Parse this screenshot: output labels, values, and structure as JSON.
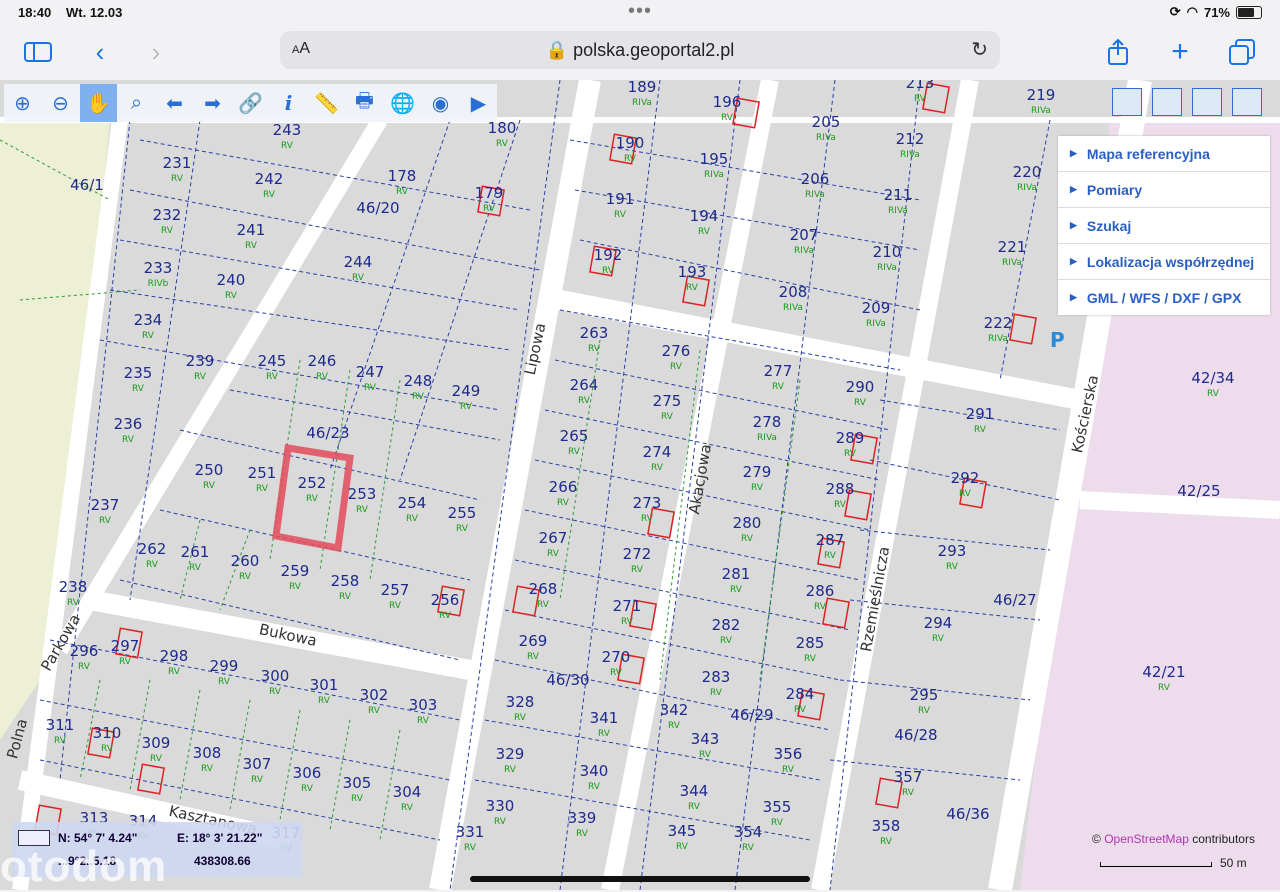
{
  "status": {
    "time": "18:40",
    "date": "Wt. 12.03",
    "battery": "71%"
  },
  "browser": {
    "aa": "AA",
    "url": "polska.geoportal2.pl"
  },
  "menu": [
    "Mapa referencyjna",
    "Pomiary",
    "Szukaj",
    "Lokalizacja współrzędnej",
    "GML / WFS / DXF / GPX"
  ],
  "coords": {
    "n": "N: 54° 7' 4.24\"",
    "e": "E: 18° 3' 21.22\"",
    "y": "438308.66",
    "x": "...9°2..5.18"
  },
  "attribution": {
    "prefix": "©",
    "osm": "OpenStreetMap",
    "suffix": "contributors"
  },
  "scale": "50 m",
  "watermark": "otodom",
  "streets": [
    "Lipowa",
    "Akacjowa",
    "Rzemieślnicza",
    "Kościerska",
    "Bukowa",
    "Parkowa",
    "Polna",
    "Kasztanowa"
  ],
  "parcels": [
    {
      "n": "243",
      "c": "RV"
    },
    {
      "n": "180",
      "c": "RV"
    },
    {
      "n": "189",
      "c": "RIVa"
    },
    {
      "n": "196",
      "c": "RV"
    },
    {
      "n": "205",
      "c": "RIVa"
    },
    {
      "n": "212",
      "c": "RIVa"
    },
    {
      "n": "213",
      "c": "RV"
    },
    {
      "n": "219",
      "c": "RIVa"
    },
    {
      "n": "231",
      "c": "RV"
    },
    {
      "n": "242",
      "c": "RV"
    },
    {
      "n": "178",
      "c": "RV"
    },
    {
      "n": "179",
      "c": "RV"
    },
    {
      "n": "190",
      "c": "RV"
    },
    {
      "n": "195",
      "c": "RIVa"
    },
    {
      "n": "206",
      "c": "RIVa"
    },
    {
      "n": "211",
      "c": "RIVa"
    },
    {
      "n": "220",
      "c": "RIVa"
    },
    {
      "n": "46/1",
      "c": ""
    },
    {
      "n": "232",
      "c": "RV"
    },
    {
      "n": "241",
      "c": "RV"
    },
    {
      "n": "46/20",
      "c": ""
    },
    {
      "n": "191",
      "c": "RV"
    },
    {
      "n": "194",
      "c": "RV"
    },
    {
      "n": "207",
      "c": "RIVa"
    },
    {
      "n": "210",
      "c": "RIVa"
    },
    {
      "n": "221",
      "c": "RIVa"
    },
    {
      "n": "233",
      "c": "RIVb"
    },
    {
      "n": "240",
      "c": "RV"
    },
    {
      "n": "244",
      "c": "RV"
    },
    {
      "n": "192",
      "c": "RV"
    },
    {
      "n": "193",
      "c": "RV"
    },
    {
      "n": "208",
      "c": "RIVa"
    },
    {
      "n": "209",
      "c": "RIVa"
    },
    {
      "n": "222",
      "c": "RIVa"
    },
    {
      "n": "234",
      "c": "RV"
    },
    {
      "n": "239",
      "c": "RV"
    },
    {
      "n": "245",
      "c": "RV"
    },
    {
      "n": "246",
      "c": "RV"
    },
    {
      "n": "247",
      "c": "RV"
    },
    {
      "n": "248",
      "c": "RV"
    },
    {
      "n": "249",
      "c": "RV"
    },
    {
      "n": "263",
      "c": "RV"
    },
    {
      "n": "276",
      "c": "RV"
    },
    {
      "n": "277",
      "c": "RV"
    },
    {
      "n": "290",
      "c": "RV"
    },
    {
      "n": "235",
      "c": "RV"
    },
    {
      "n": "236",
      "c": "RV"
    },
    {
      "n": "46/23",
      "c": ""
    },
    {
      "n": "264",
      "c": "RV"
    },
    {
      "n": "275",
      "c": "RV"
    },
    {
      "n": "278",
      "c": "RIVa"
    },
    {
      "n": "289",
      "c": "RV"
    },
    {
      "n": "291",
      "c": "RV"
    },
    {
      "n": "42/34",
      "c": "RV"
    },
    {
      "n": "250",
      "c": "RV"
    },
    {
      "n": "251",
      "c": "RV"
    },
    {
      "n": "252",
      "c": "RV"
    },
    {
      "n": "253",
      "c": "RV"
    },
    {
      "n": "254",
      "c": "RV"
    },
    {
      "n": "255",
      "c": "RV"
    },
    {
      "n": "265",
      "c": "RV"
    },
    {
      "n": "274",
      "c": "RV"
    },
    {
      "n": "279",
      "c": "RV"
    },
    {
      "n": "288",
      "c": "RV"
    },
    {
      "n": "292",
      "c": "RV"
    },
    {
      "n": "42/25",
      "c": ""
    },
    {
      "n": "237",
      "c": "RV"
    },
    {
      "n": "266",
      "c": "RV"
    },
    {
      "n": "273",
      "c": "RV"
    },
    {
      "n": "280",
      "c": "RV"
    },
    {
      "n": "287",
      "c": "RV"
    },
    {
      "n": "293",
      "c": "RV"
    },
    {
      "n": "262",
      "c": "RV"
    },
    {
      "n": "261",
      "c": "RV"
    },
    {
      "n": "260",
      "c": "RV"
    },
    {
      "n": "259",
      "c": "RV"
    },
    {
      "n": "258",
      "c": "RV"
    },
    {
      "n": "257",
      "c": "RV"
    },
    {
      "n": "256",
      "c": "RV"
    },
    {
      "n": "267",
      "c": "RV"
    },
    {
      "n": "272",
      "c": "RV"
    },
    {
      "n": "281",
      "c": "RV"
    },
    {
      "n": "286",
      "c": "RV"
    },
    {
      "n": "46/27",
      "c": ""
    },
    {
      "n": "238",
      "c": "RV"
    },
    {
      "n": "268",
      "c": "RV"
    },
    {
      "n": "271",
      "c": "RV"
    },
    {
      "n": "282",
      "c": "RV"
    },
    {
      "n": "294",
      "c": "RV"
    },
    {
      "n": "296",
      "c": "RV"
    },
    {
      "n": "297",
      "c": "RV"
    },
    {
      "n": "298",
      "c": "RV"
    },
    {
      "n": "299",
      "c": "RV"
    },
    {
      "n": "269",
      "c": "RV"
    },
    {
      "n": "270",
      "c": "RV"
    },
    {
      "n": "285",
      "c": "RV"
    },
    {
      "n": "42/21",
      "c": "RV"
    },
    {
      "n": "300",
      "c": "RV"
    },
    {
      "n": "301",
      "c": "RV"
    },
    {
      "n": "302",
      "c": "RV"
    },
    {
      "n": "303",
      "c": "RV"
    },
    {
      "n": "46/30",
      "c": ""
    },
    {
      "n": "283",
      "c": "RV"
    },
    {
      "n": "284",
      "c": "RV"
    },
    {
      "n": "295",
      "c": "RV"
    },
    {
      "n": "311",
      "c": "RV"
    },
    {
      "n": "310",
      "c": "RV"
    },
    {
      "n": "309",
      "c": "RV"
    },
    {
      "n": "308",
      "c": "RV"
    },
    {
      "n": "328",
      "c": "RV"
    },
    {
      "n": "341",
      "c": "RV"
    },
    {
      "n": "342",
      "c": "RV"
    },
    {
      "n": "46/29",
      "c": ""
    },
    {
      "n": "46/28",
      "c": ""
    },
    {
      "n": "307",
      "c": "RV"
    },
    {
      "n": "306",
      "c": "RV"
    },
    {
      "n": "305",
      "c": "RV"
    },
    {
      "n": "304",
      "c": "RV"
    },
    {
      "n": "329",
      "c": "RV"
    },
    {
      "n": "340",
      "c": "RV"
    },
    {
      "n": "343",
      "c": "RV"
    },
    {
      "n": "356",
      "c": "RV"
    },
    {
      "n": "357",
      "c": "RV"
    },
    {
      "n": "330",
      "c": "RV"
    },
    {
      "n": "339",
      "c": "RV"
    },
    {
      "n": "344",
      "c": "RV"
    },
    {
      "n": "355",
      "c": "RV"
    },
    {
      "n": "46/36",
      "c": ""
    },
    {
      "n": "313",
      "c": "RV"
    },
    {
      "n": "314",
      "c": "RV"
    },
    {
      "n": "317",
      "c": "RV"
    },
    {
      "n": "331",
      "c": "RV"
    },
    {
      "n": "345",
      "c": "RV"
    },
    {
      "n": "354",
      "c": "RV"
    },
    {
      "n": "358",
      "c": "RV"
    }
  ],
  "highlighted_parcel": "252"
}
